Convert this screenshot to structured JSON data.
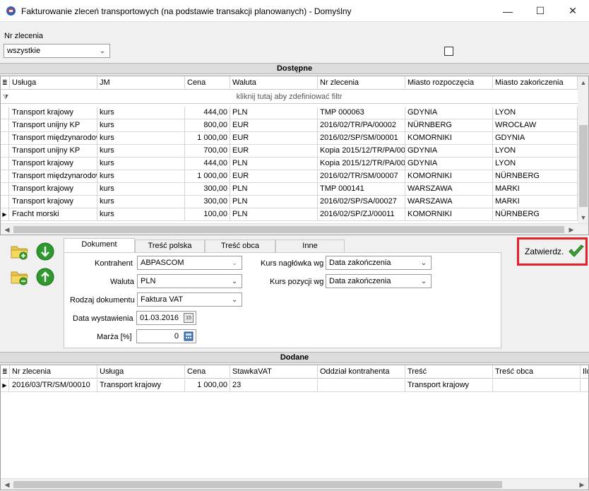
{
  "window": {
    "title": "Fakturowanie zleceń transportowych (na podstawie transakcji planowanych) - Domyślny",
    "minimize": "—",
    "maximize": "☐",
    "close": "✕"
  },
  "filter": {
    "nr_zlecenia_label": "Nr zlecenia",
    "nr_zlecenia_value": "wszystkie"
  },
  "dostepne": {
    "header": "Dostępne",
    "filter_hint": "kliknij tutaj aby zdefiniować filtr",
    "columns": [
      "Usługa",
      "JM",
      "Cena",
      "Waluta",
      "Nr zlecenia",
      "Miasto rozpoczęcia",
      "Miasto zakończenia"
    ],
    "rows": [
      [
        "Transport krajowy",
        "kurs",
        "444,00",
        "PLN",
        "TMP 000063",
        "GDYNIA",
        "LYON"
      ],
      [
        "Transport unijny KP",
        "kurs",
        "800,00",
        "EUR",
        "2016/02/TR/PA/00002",
        "NÜRNBERG",
        "WROCŁAW"
      ],
      [
        "Transport międzynarodowy",
        "kurs",
        "1 000,00",
        "EUR",
        "2016/02/SP/SM/00001",
        "KOMORNIKI",
        "GDYNIA"
      ],
      [
        "Transport unijny KP",
        "kurs",
        "700,00",
        "EUR",
        "Kopia 2015/12/TR/PA/00",
        "GDYNIA",
        "LYON"
      ],
      [
        "Transport krajowy",
        "kurs",
        "444,00",
        "PLN",
        "Kopia 2015/12/TR/PA/00",
        "GDYNIA",
        "LYON"
      ],
      [
        "Transport międzynarodowy",
        "kurs",
        "1 000,00",
        "EUR",
        "2016/02/TR/SM/00007",
        "KOMORNIKI",
        "NÜRNBERG"
      ],
      [
        "Transport krajowy",
        "kurs",
        "300,00",
        "PLN",
        "TMP 000141",
        "WARSZAWA",
        "MARKI"
      ],
      [
        "Transport krajowy",
        "kurs",
        "300,00",
        "PLN",
        "2016/02/SP/SA/00027",
        "WARSZAWA",
        "MARKI"
      ],
      [
        "Fracht morski",
        "kurs",
        "100,00",
        "PLN",
        "2016/02/SP/ZJ/00011",
        "KOMORNIKI",
        "NÜRNBERG"
      ]
    ]
  },
  "tabs": [
    "Dokument",
    "Treść polska",
    "Treść obca",
    "Inne"
  ],
  "form": {
    "kontrahent_label": "Kontrahent",
    "kontrahent_value": "ABPASCOM",
    "waluta_label": "Waluta",
    "waluta_value": "PLN",
    "rodzaj_label": "Rodzaj dokumentu",
    "rodzaj_value": "Faktura VAT",
    "data_label": "Data wystawienia",
    "data_value": "01.03.2016",
    "marza_label": "Marża [%]",
    "marza_value": "0",
    "kurs_naglowka_label": "Kurs nagłówka wg",
    "kurs_naglowka_value": "Data zakończenia",
    "kurs_pozycji_label": "Kurs pozycji wg",
    "kurs_pozycji_value": "Data zakończenia"
  },
  "confirm": {
    "label": "Zatwierdz."
  },
  "dodane": {
    "header": "Dodane",
    "columns": [
      "Nr zlecenia",
      "Usługa",
      "Cena",
      "StawkaVAT",
      "Oddział kontrahenta",
      "Treść",
      "Treść obca",
      "Ilo"
    ],
    "rows": [
      [
        "2016/03/TR/SM/00010",
        "Transport krajowy",
        "1 000,00",
        "23",
        "",
        "Transport krajowy",
        "",
        ""
      ]
    ]
  },
  "colors": {
    "highlight_border": "#e5202a",
    "check_green": "#3aa72c",
    "arrow_green": "#2e9a2e"
  }
}
